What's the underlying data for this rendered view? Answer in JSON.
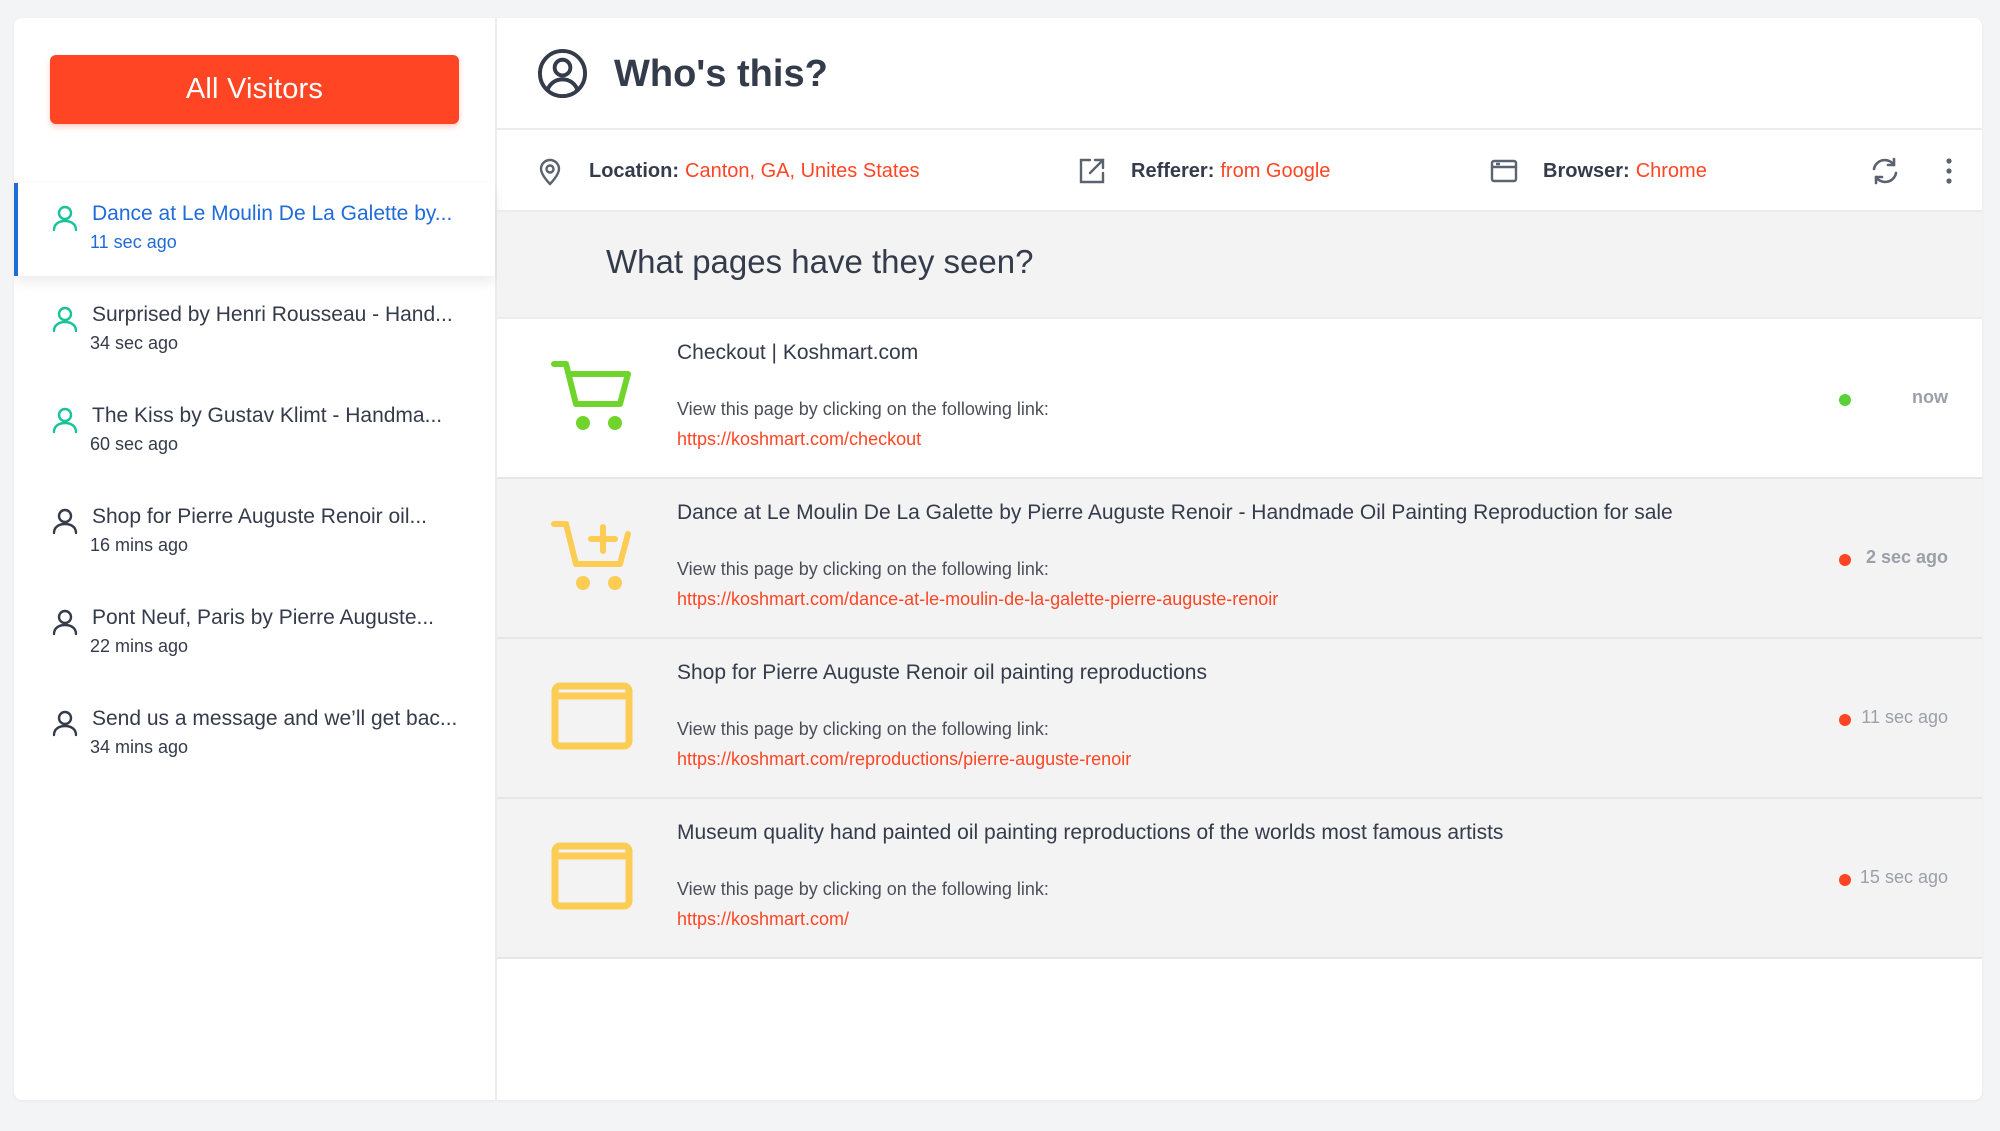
{
  "sidebar": {
    "all_visitors_label": "All Visitors",
    "visitors": [
      {
        "title": "Dance at Le Moulin De La Galette by...",
        "time": "11 sec ago",
        "online": true,
        "active": true
      },
      {
        "title": "Surprised by Henri Rousseau - Hand...",
        "time": "34 sec ago",
        "online": true,
        "active": false
      },
      {
        "title": "The Kiss by Gustav Klimt - Handma...",
        "time": "60 sec ago",
        "online": true,
        "active": false
      },
      {
        "title": "Shop for Pierre Auguste Renoir oil...",
        "time": "16 mins ago",
        "online": false,
        "active": false
      },
      {
        "title": "Pont Neuf, Paris by Pierre Auguste...",
        "time": "22 mins ago",
        "online": false,
        "active": false
      },
      {
        "title": "Send us a message and we’ll get bac...",
        "time": "34 mins ago",
        "online": false,
        "active": false
      }
    ]
  },
  "header": {
    "title": "Who's this?"
  },
  "info": {
    "location_label": "Location:",
    "location_value": "Canton, GA, Unites States",
    "referrer_label": "Refferer:",
    "referrer_value": "from Google",
    "browser_label": "Browser:",
    "browser_value": "Chrome"
  },
  "pages_heading": "What pages have they seen?",
  "pages": [
    {
      "icon": "shopping-cart-icon",
      "title": "Checkout | Koshmart.com",
      "hint": "View this page by clicking on the following link:",
      "link": "https://koshmart.com/checkout",
      "time": "now",
      "status": "active"
    },
    {
      "icon": "add-to-cart-icon",
      "title": "Dance at Le Moulin De La Galette by Pierre Auguste Renoir - Handmade Oil Painting Reproduction for sale",
      "hint": "View this page by clicking on the following link:",
      "link": "https://koshmart.com/dance-at-le-moulin-de-la-galette-pierre-auguste-renoir",
      "time": "2 sec ago",
      "status": "left"
    },
    {
      "icon": "browser-window-icon",
      "title": "Shop for Pierre Auguste Renoir oil painting reproductions",
      "hint": "View this page by clicking on the following link:",
      "link": "https://koshmart.com/reproductions/pierre-auguste-renoir",
      "time": "11 sec ago",
      "status": "left"
    },
    {
      "icon": "browser-window-icon",
      "title": "Museum quality hand painted oil painting reproductions of the worlds most famous artists",
      "hint": "View this page by clicking on the following link:",
      "link": "https://koshmart.com/",
      "time": "15 sec ago",
      "status": "left"
    }
  ],
  "colors": {
    "accent": "#ff4524",
    "active_blue": "#1f6bd8",
    "online_green": "#19c39a",
    "status_green": "#5ad03b",
    "cart_green": "#6fd42c",
    "icon_yellow": "#fccc55",
    "text": "#343b4a"
  }
}
